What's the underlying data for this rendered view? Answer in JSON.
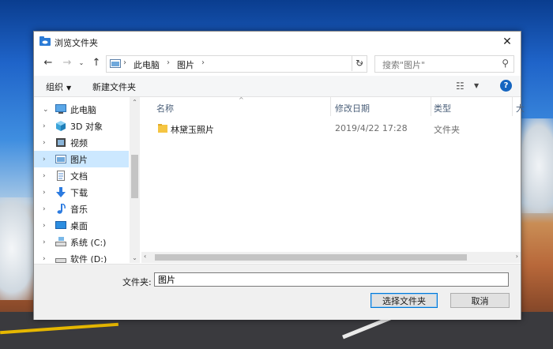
{
  "window": {
    "title": "浏览文件夹",
    "close": "✕"
  },
  "address": {
    "crumbs": [
      "此电脑",
      "图片"
    ],
    "search_placeholder": "搜索\"图片\""
  },
  "toolbar": {
    "organize": "组织",
    "new_folder": "新建文件夹",
    "help": "?"
  },
  "sidebar": {
    "items": [
      {
        "label": "此电脑",
        "icon": "computer-icon",
        "arrow": "⌄"
      },
      {
        "label": "3D 对象",
        "icon": "cube-3d-icon",
        "arrow": "›"
      },
      {
        "label": "视频",
        "icon": "video-icon",
        "arrow": "›"
      },
      {
        "label": "图片",
        "icon": "picture-icon",
        "arrow": "›",
        "selected": true
      },
      {
        "label": "文档",
        "icon": "document-icon",
        "arrow": "›"
      },
      {
        "label": "下载",
        "icon": "download-icon",
        "arrow": "›"
      },
      {
        "label": "音乐",
        "icon": "music-icon",
        "arrow": "›"
      },
      {
        "label": "桌面",
        "icon": "desktop-icon",
        "arrow": "›"
      },
      {
        "label": "系统 (C:)",
        "icon": "drive-c-icon",
        "arrow": "›"
      },
      {
        "label": "软件 (D:)",
        "icon": "drive-d-icon",
        "arrow": "›"
      }
    ]
  },
  "columns": {
    "name": "名称",
    "date": "修改日期",
    "type": "类型",
    "more": "大"
  },
  "files": [
    {
      "name": "林黛玉照片",
      "date": "2019/4/22 17:28",
      "type": "文件夹"
    }
  ],
  "footer": {
    "folder_label": "文件夹:",
    "folder_value": "图片",
    "select_button": "选择文件夹",
    "cancel_button": "取消"
  },
  "colors": {
    "selected": "#cce8ff",
    "accent": "#0078d7",
    "help": "#1565c0",
    "folder": "#f5c542"
  }
}
